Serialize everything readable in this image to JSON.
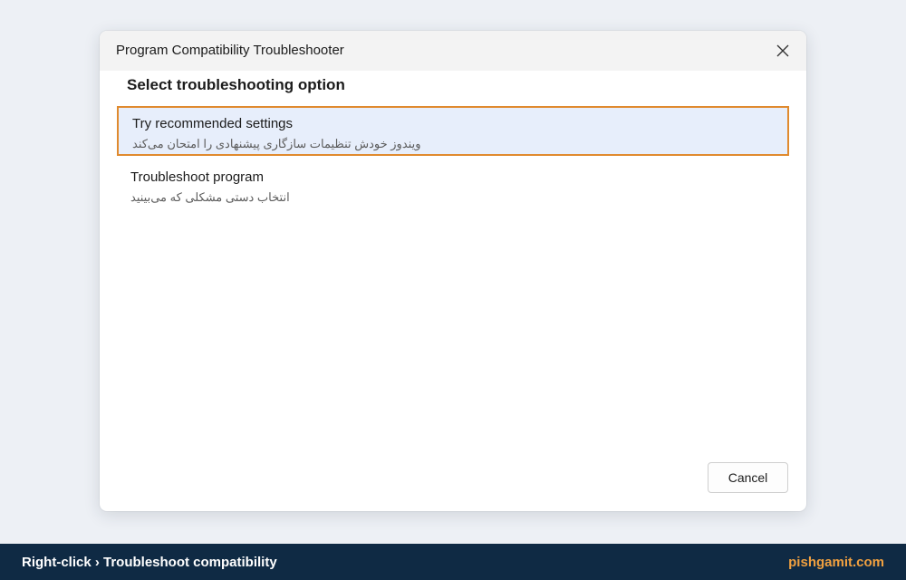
{
  "dialog": {
    "title": "Program Compatibility Troubleshooter",
    "heading": "Select troubleshooting option",
    "options": [
      {
        "title": "Try recommended settings",
        "description": "ویندوز خودش تنظیمات سازگاری پیشنهادی را امتحان می‌کند",
        "selected": true
      },
      {
        "title": "Troubleshoot program",
        "description": "انتخاب دستی مشکلی که می‌بینید",
        "selected": false
      }
    ],
    "cancel_label": "Cancel",
    "close_icon": "close-icon"
  },
  "footer": {
    "caption": "Right-click › Troubleshoot compatibility",
    "brand": "pishgamit.com",
    "brand_color": "#f0a040"
  },
  "colors": {
    "selected_border": "#e08a2e",
    "selected_background": "#e7eefb",
    "footer_background": "#0f2a44",
    "page_background": "#edf0f5"
  }
}
